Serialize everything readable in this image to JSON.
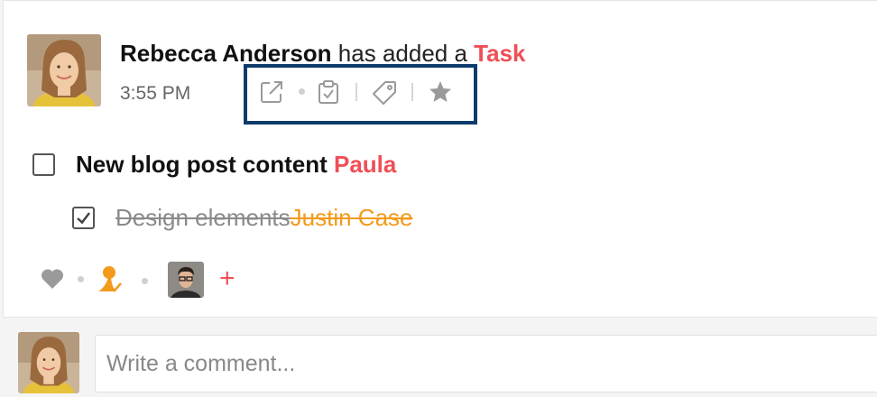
{
  "post": {
    "author": "Rebecca Anderson",
    "verb": "has added a",
    "object_type": "Task",
    "time": "3:55 PM"
  },
  "actions": {
    "icons": [
      "external-link-icon",
      "clipboard-check-icon",
      "tag-icon",
      "star-icon"
    ]
  },
  "task": {
    "title": "New blog post content",
    "assignee": "Paula",
    "checked": false,
    "subtasks": [
      {
        "title": "Design elements",
        "assignee": "Justin Case",
        "checked": true
      }
    ]
  },
  "reactions": {
    "icons": [
      "heart-icon",
      "assign-user-icon",
      "participant-avatar",
      "add-icon"
    ],
    "add_label": "+"
  },
  "comment": {
    "placeholder": "Write a comment..."
  },
  "colors": {
    "accent_red": "#ef4f56",
    "accent_orange": "#f39a1c",
    "highlight_box": "#0d3c6b"
  }
}
